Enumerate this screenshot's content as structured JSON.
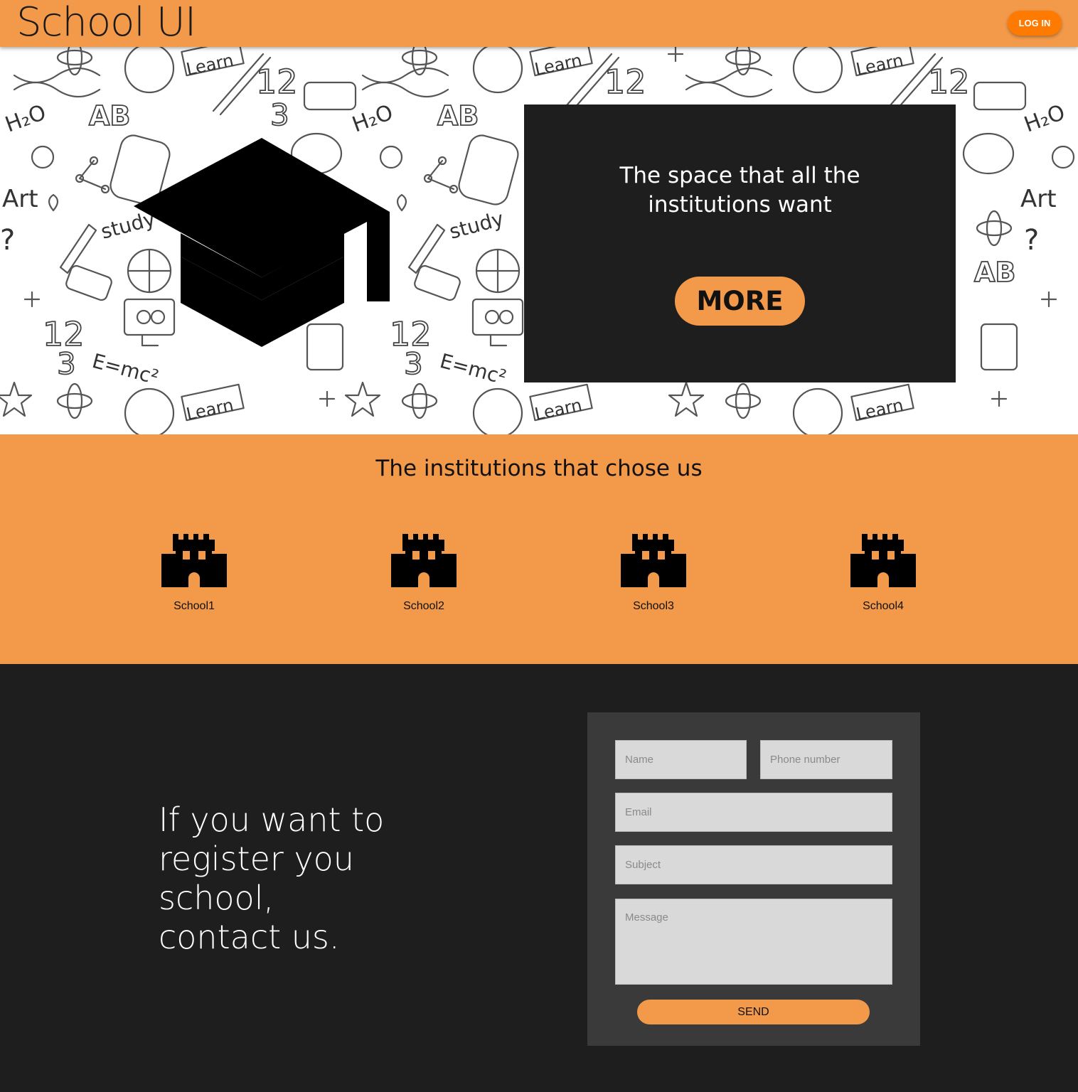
{
  "header": {
    "brand": "School UI",
    "login_label": "LOG IN"
  },
  "hero": {
    "headline_line1": "The space that all the",
    "headline_line2": "institutions want",
    "more_label": "MORE",
    "background_doodles": [
      "Learn",
      "H2O",
      "AB",
      "Art",
      "Study",
      "12",
      "3",
      "E=mc²"
    ]
  },
  "institutions": {
    "title": "The institutions that chose us",
    "schools": [
      {
        "name": "School1",
        "icon": "castle-icon"
      },
      {
        "name": "School2",
        "icon": "castle-icon"
      },
      {
        "name": "School3",
        "icon": "castle-icon"
      },
      {
        "name": "School4",
        "icon": "castle-icon"
      }
    ]
  },
  "contact": {
    "text": "If you want to register you school, contact us.",
    "form": {
      "name_placeholder": "Name",
      "phone_placeholder": "Phone number",
      "email_placeholder": "Email",
      "subject_placeholder": "Subject",
      "message_placeholder": "Message",
      "send_label": "SEND"
    }
  },
  "colors": {
    "accent": "#f2994a",
    "login_button": "#ff7a00",
    "dark": "#1e1e1e",
    "form_panel": "#3a3a3a",
    "input": "#d9d9d9"
  }
}
